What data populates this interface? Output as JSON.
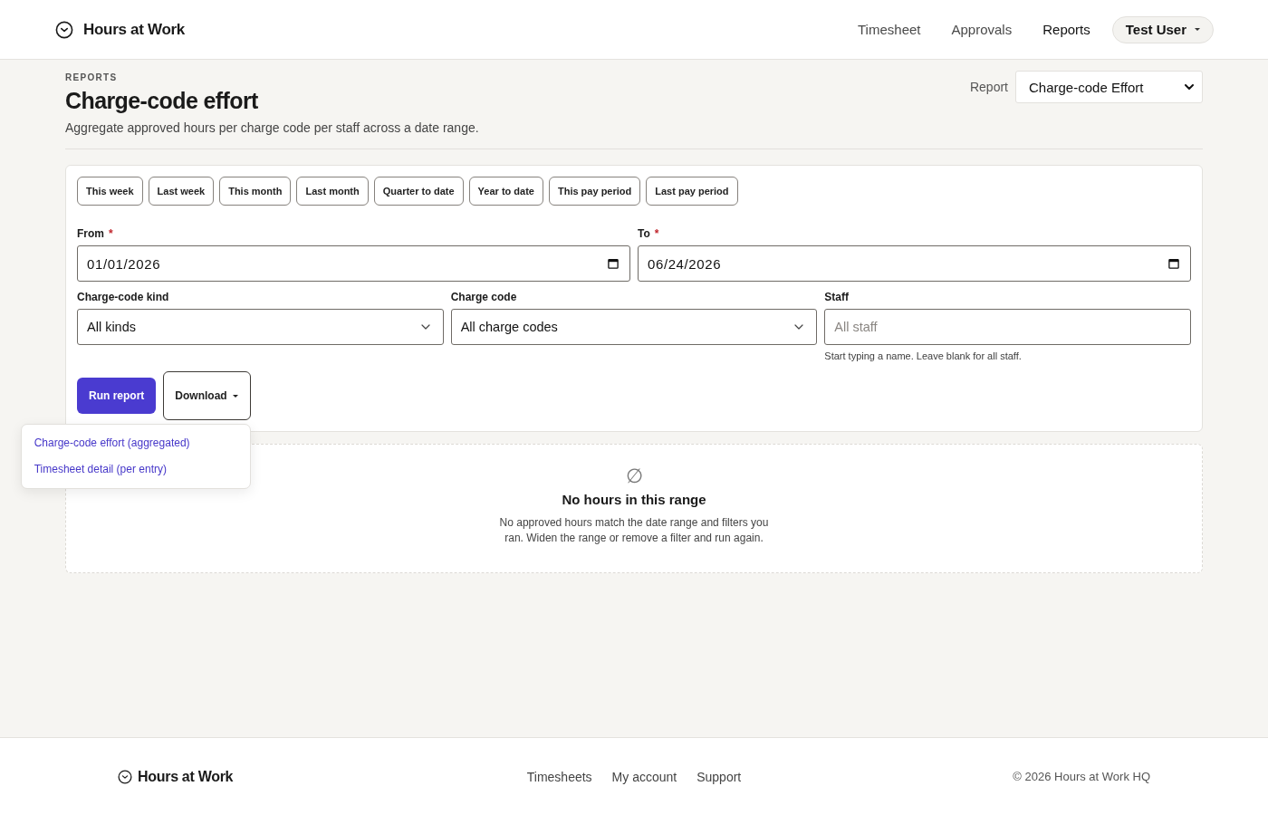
{
  "header": {
    "brand": "Hours at Work",
    "nav": [
      {
        "label": "Timesheet",
        "selected": false
      },
      {
        "label": "Approvals",
        "selected": false
      },
      {
        "label": "Reports",
        "selected": true
      }
    ],
    "user_menu": {
      "label": "Test User"
    }
  },
  "page": {
    "eyebrow": "REPORTS",
    "title": "Charge-code effort",
    "subtitle": "Aggregate approved hours per charge code per staff across a date range.",
    "report_select": {
      "label": "Report",
      "value": "Charge-code Effort"
    }
  },
  "filters": {
    "presets": [
      "This week",
      "Last week",
      "This month",
      "Last month",
      "Quarter to date",
      "Year to date",
      "This pay period",
      "Last pay period"
    ],
    "dates": [
      {
        "label": "From",
        "required_mark": "*",
        "value": "01/01/2026"
      },
      {
        "label": "To",
        "required_mark": "*",
        "value": "06/24/2026"
      }
    ],
    "selects": [
      {
        "kind": "select",
        "label": "Charge-code kind",
        "value": "All kinds"
      },
      {
        "kind": "select",
        "label": "Charge code",
        "value": "All charge codes"
      },
      {
        "kind": "text",
        "label": "Staff",
        "placeholder": "All staff",
        "hint": "Start typing a name. Leave blank for all staff."
      }
    ]
  },
  "actions": {
    "run": "Run report",
    "download": {
      "label": "Download",
      "expanded": true,
      "menu": [
        "Charge-code effort (aggregated)",
        "Timesheet detail (per entry)"
      ]
    }
  },
  "empty_state": {
    "symbol": "∅",
    "title": "No hours in this range",
    "text": "No approved hours match the date range and filters you ran. Widen the range or remove a filter and run again."
  },
  "footer": {
    "brand": "Hours at Work",
    "links": [
      "Timesheets",
      "My account",
      "Support"
    ],
    "copyright": "© 2026 Hours at Work HQ"
  }
}
